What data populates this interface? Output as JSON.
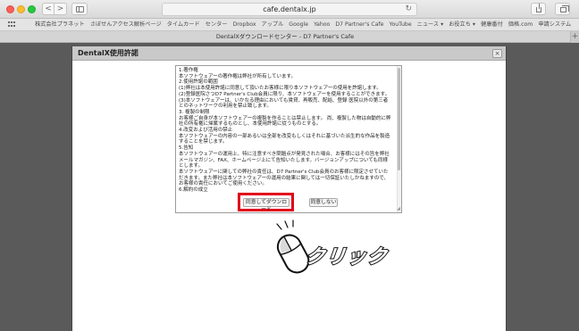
{
  "browser": {
    "url": "cafe.dentalx.jp",
    "tab_title": "DentalXダウンロードセンター - D7 Partner's Cafe",
    "back_symbol": "<",
    "forward_symbol": ">",
    "reload_symbol": "↻",
    "new_tab_symbol": "+",
    "bookmarks": [
      "株式会社プラネット",
      "さぼせんアクセス解析ページ",
      "タイムカード",
      "センター",
      "Dropbox",
      "アップル",
      "Google",
      "Yahoo",
      "D7 Partner's Cafe",
      "YouTube",
      "ニュース ▾",
      "お役立ち ▾",
      "健康番付",
      "価格.com",
      "申請システム"
    ]
  },
  "modal": {
    "title": "DentalX使用許諾",
    "close_symbol": "×",
    "terms": [
      "1.著作権",
      "本ソフトウェアーの著作権は弊社が所有しています。",
      "2.使用許諾の範囲",
      "(1)弊社は本使用許諾に同意して頂いたお客様に限り本ソフトウェアーの使用を許諾します。",
      "(2)登録医院さつD7 Partner's Club会員に限り、本ソフトウェアーを使用することができます。",
      "(3)本ソフトウェアーは、いかなる理由においても賃貸、再販売、配給、登録 医院以外の第三者とのネットワークの利用を禁止致します。",
      "3. 複製の制限",
      "お客様ご自身が本ソフトウェアーの複製を作ることは禁止します。 尚、複製した物は自動的に弊社の所有権に帰属するものとし、本使用許諾に従うものとする。",
      "4.改変および活用の禁止",
      "本ソフトウェアーの内容の一部あるいは全部を改変もしくはそれに基づいた派生的な作品を製造することを禁じます。",
      "5.告知",
      "本ソフトウェアーの運用上、特に注意すべき問題点が発見された場合、お客様にはその旨を弊社メールマガジン、FAX、ホームページ上にて告知いたします。バージョンアップについても同様とします。",
      "本ソフトウェアーに関しての弊社の責任は、D7 Partner's Club会員のお客様に限定させていただきます。また弊社は本ソフトウェアーの運用の結果に関しては一切保証いたしかねますので、お客様の責任においてご使用ください。",
      "6.解約の成立"
    ],
    "agree_button": "同意してダウンロード",
    "disagree_button": "同意しない"
  },
  "annotation": {
    "click_text": "クリック",
    "highlight_color": "#e2001a"
  }
}
